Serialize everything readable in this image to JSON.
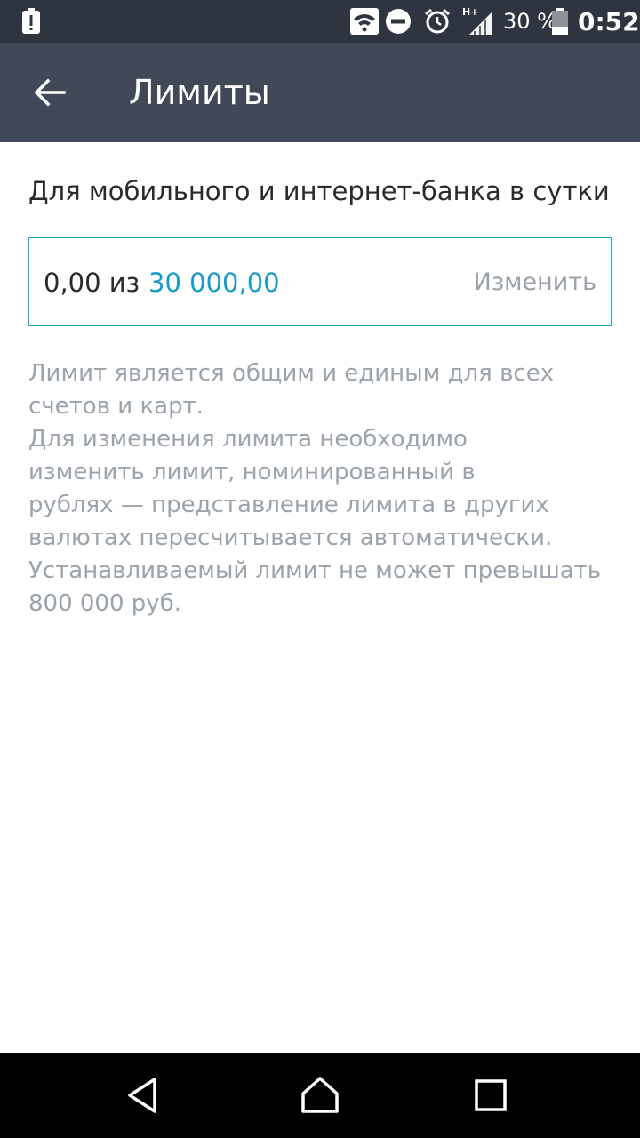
{
  "status_bar": {
    "battery_percent": "30 %",
    "time": "0:52",
    "network_type": "H+",
    "icons": [
      "alert-notification-icon",
      "wifi-icon",
      "do-not-disturb-icon",
      "alarm-icon",
      "signal-icon",
      "battery-icon"
    ]
  },
  "app_bar": {
    "title": "Лимиты",
    "back_icon": "arrow-back-icon"
  },
  "limit": {
    "section_title": "Для мобильного и интернет-банка в сутки",
    "current": "0,00 из",
    "max": "30 000,00",
    "change_label": "Изменить",
    "accent_color": "#1a9bc4"
  },
  "description": {
    "lines": [
      "Лимит является общим и единым для всех",
      "счетов и карт.",
      "Для изменения лимита необходимо",
      "изменить лимит, номинированный в",
      "рублях — представление лимита в других",
      "валютах пересчитывается автоматически.",
      "Устанавливаемый лимит не может превышать",
      "800 000 руб."
    ]
  },
  "nav_bar": {
    "icons": [
      "nav-back-icon",
      "nav-home-icon",
      "nav-recents-icon"
    ]
  }
}
